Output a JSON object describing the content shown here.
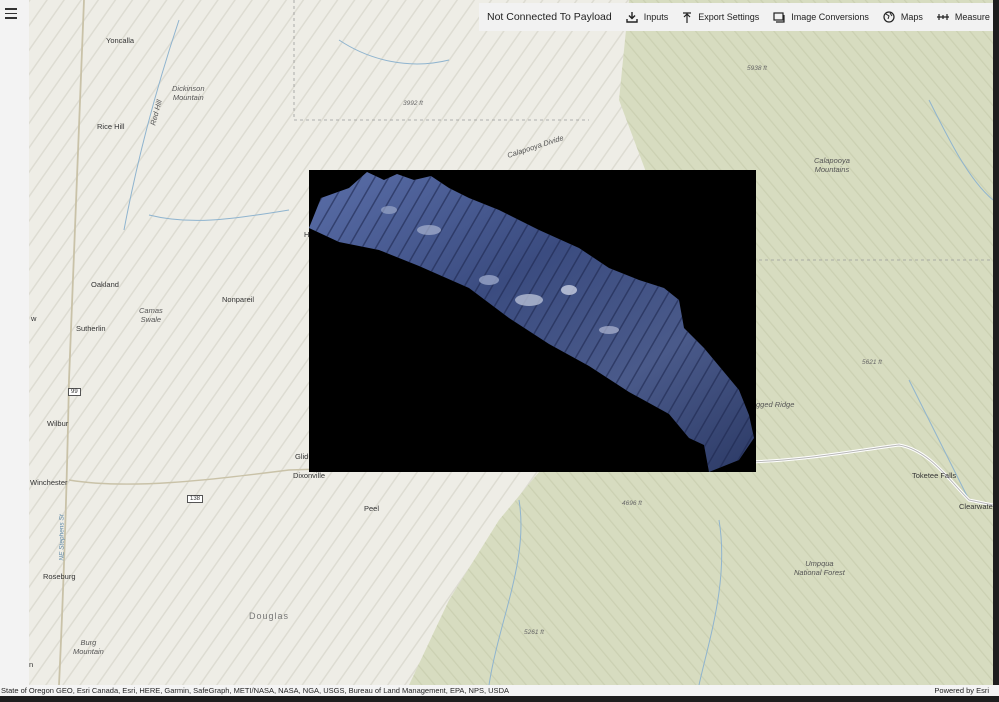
{
  "toolbar": {
    "status": "Not Connected To Payload",
    "inputs": "Inputs",
    "export_settings": "Export Settings",
    "image_conversions": "Image Conversions",
    "maps": "Maps",
    "measure": "Measure",
    "more": "..."
  },
  "map_labels": {
    "yoncalla": "Yoncalla",
    "dickinson": "Dickinson\nMountain",
    "red_hill": "Red Hill",
    "rice_hill": "Rice Hill",
    "oakland": "Oakland",
    "camas_swale": "Camas\nSwale",
    "nonpareil": "Nonpareil",
    "sutherlin": "Sutherlin",
    "wilbur": "Wilbur",
    "winchester": "Winchester",
    "roseburg": "Roseburg",
    "dixonville": "Dixonville",
    "glide": "Glid",
    "peel": "Peel",
    "douglas": "Douglas",
    "burg_mountain": "Burg\nMountain",
    "calapooya_divide": "Calapooya Divide",
    "calapooya_mountains": "Calapooya\nMountains",
    "jagged_ridge": "gged Ridge",
    "toketee_falls": "Toketee Falls",
    "clearwater": "Clearwate",
    "umpqua": "Umpqua\nNational Forest",
    "elev_3992": "3992 ft",
    "elev_5938": "5938 ft",
    "elev_5621": "5621 ft",
    "elev_4696": "4696 ft",
    "elev_5261": "5261 ft",
    "hwy_99": "99",
    "hwy_138": "138",
    "ne_stephens": "NE Stephens St",
    "w_label": "w",
    "n_label": "n",
    "h_label": "H"
  },
  "attribution": {
    "sources": "State of Oregon GEO, Esri Canada, Esri, HERE, Garmin, SafeGraph, METI/NASA, NASA, NGA, USGS, Bureau of Land Management, EPA, NPS, USDA",
    "powered_by": "Powered by Esri"
  },
  "colors": {
    "map_base": "#eeede6",
    "forest_green": "#d7dcc0",
    "overlay_bg": "#000000",
    "imagery_blue": "#3b4c80"
  }
}
